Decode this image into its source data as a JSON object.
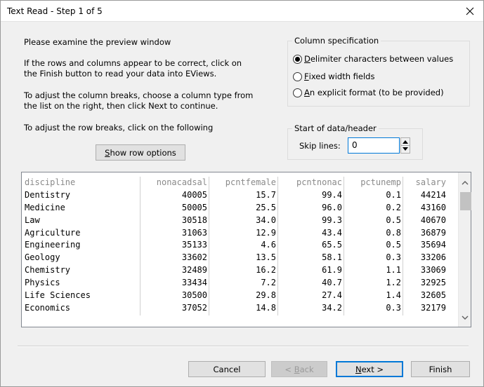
{
  "window": {
    "title": "Text Read - Step 1 of 5"
  },
  "instructions": {
    "p1": "Please examine the preview window",
    "p2_line1": "If the rows and columns appear to be correct, click on",
    "p2_line2": "the Finish button to read your data into EViews.",
    "p3_line1": "To adjust the column breaks, choose a column type from",
    "p3_line2": "the list on the right, then click Next to continue.",
    "p4": "To adjust the row breaks, click on the following"
  },
  "show_row_options": {
    "accel": "S",
    "rest": "how row options"
  },
  "column_spec": {
    "legend": "Column specification",
    "options": [
      {
        "accel": "D",
        "rest": "elimiter characters between values",
        "selected": true
      },
      {
        "accel": "F",
        "rest": "ixed width fields",
        "selected": false
      },
      {
        "accel": "A",
        "rest": "n explicit format (to be provided)",
        "selected": false
      }
    ]
  },
  "start_data": {
    "legend": "Start of data/header",
    "skip_label": "Skip lines:",
    "skip_value": "0"
  },
  "preview": {
    "columns": [
      "discipline",
      "nonacadsal",
      "pcntfemale",
      "pcntnonac",
      "pctunemp",
      "salary"
    ],
    "rows": [
      [
        "Dentistry",
        "40005",
        "15.7",
        "99.4",
        "0.1",
        "44214"
      ],
      [
        "Medicine",
        "50005",
        "25.5",
        "96.0",
        "0.2",
        "43160"
      ],
      [
        "Law",
        "30518",
        "34.0",
        "99.3",
        "0.5",
        "40670"
      ],
      [
        "Agriculture",
        "31063",
        "12.9",
        "43.4",
        "0.8",
        "36879"
      ],
      [
        "Engineering",
        "35133",
        "4.6",
        "65.5",
        "0.5",
        "35694"
      ],
      [
        "Geology",
        "33602",
        "13.5",
        "58.1",
        "0.3",
        "33206"
      ],
      [
        "Chemistry",
        "32489",
        "16.2",
        "61.9",
        "1.1",
        "33069"
      ],
      [
        "Physics",
        "33434",
        "7.2",
        "40.7",
        "1.2",
        "32925"
      ],
      [
        "Life Sciences",
        "30500",
        "29.8",
        "27.4",
        "1.4",
        "32605"
      ],
      [
        "Economics",
        "37052",
        "14.8",
        "34.2",
        "0.3",
        "32179"
      ]
    ]
  },
  "buttons": {
    "cancel": "Cancel",
    "back": {
      "prefix": "< ",
      "accel": "B",
      "rest": "ack"
    },
    "next": {
      "accel": "N",
      "rest": "ext >"
    },
    "finish": "Finish"
  },
  "icons": {
    "close": "close-icon",
    "spin_up": "chevron-up-icon",
    "spin_down": "chevron-down-icon",
    "scroll_up": "scroll-up-icon",
    "scroll_down": "scroll-down-icon"
  },
  "colors": {
    "accent": "#0078d7",
    "dialog_bg": "#f0f0f0",
    "header_text": "#8a8a8a"
  }
}
